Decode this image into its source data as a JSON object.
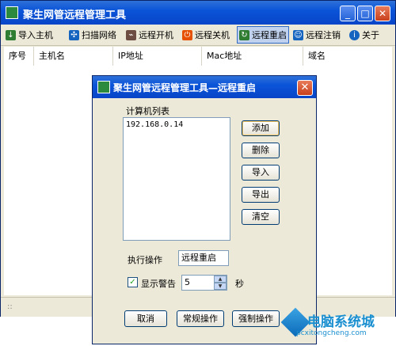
{
  "main": {
    "title": "聚生网管远程管理工具",
    "toolbar": [
      {
        "label": "导入主机",
        "icon": "import-icon",
        "color": "#2e7d32"
      },
      {
        "label": "扫描网络",
        "icon": "scan-icon",
        "color": "#1565c0"
      },
      {
        "label": "远程开机",
        "icon": "power-on-icon",
        "color": "#6d4c41"
      },
      {
        "label": "远程关机",
        "icon": "shutdown-icon",
        "color": "#e65100"
      },
      {
        "label": "远程重启",
        "icon": "restart-icon",
        "color": "#2e7d32"
      },
      {
        "label": "远程注销",
        "icon": "logoff-icon",
        "color": "#1565c0"
      },
      {
        "label": "关于",
        "icon": "info-icon",
        "color": "#1565c0"
      }
    ],
    "columns": [
      "序号",
      "主机名",
      "IP地址",
      "Mac地址",
      "域名"
    ],
    "statusbar": "::"
  },
  "dialog": {
    "title": "聚生网管远程管理工具—远程重启",
    "computer_list_label": "计算机列表",
    "computer_list": [
      "192.168.0.14"
    ],
    "side_buttons": [
      "添加",
      "删除",
      "导入",
      "导出",
      "清空"
    ],
    "operation_label": "执行操作",
    "operation_value": "远程重启",
    "warning_label": "显示警告",
    "warning_checked": true,
    "warning_seconds": "5",
    "seconds_unit": "秒",
    "bottom_buttons": [
      "取消",
      "常规操作",
      "强制操作"
    ]
  },
  "watermark": {
    "text": "电脑系统城",
    "url": "pcxitongcheng.com"
  }
}
